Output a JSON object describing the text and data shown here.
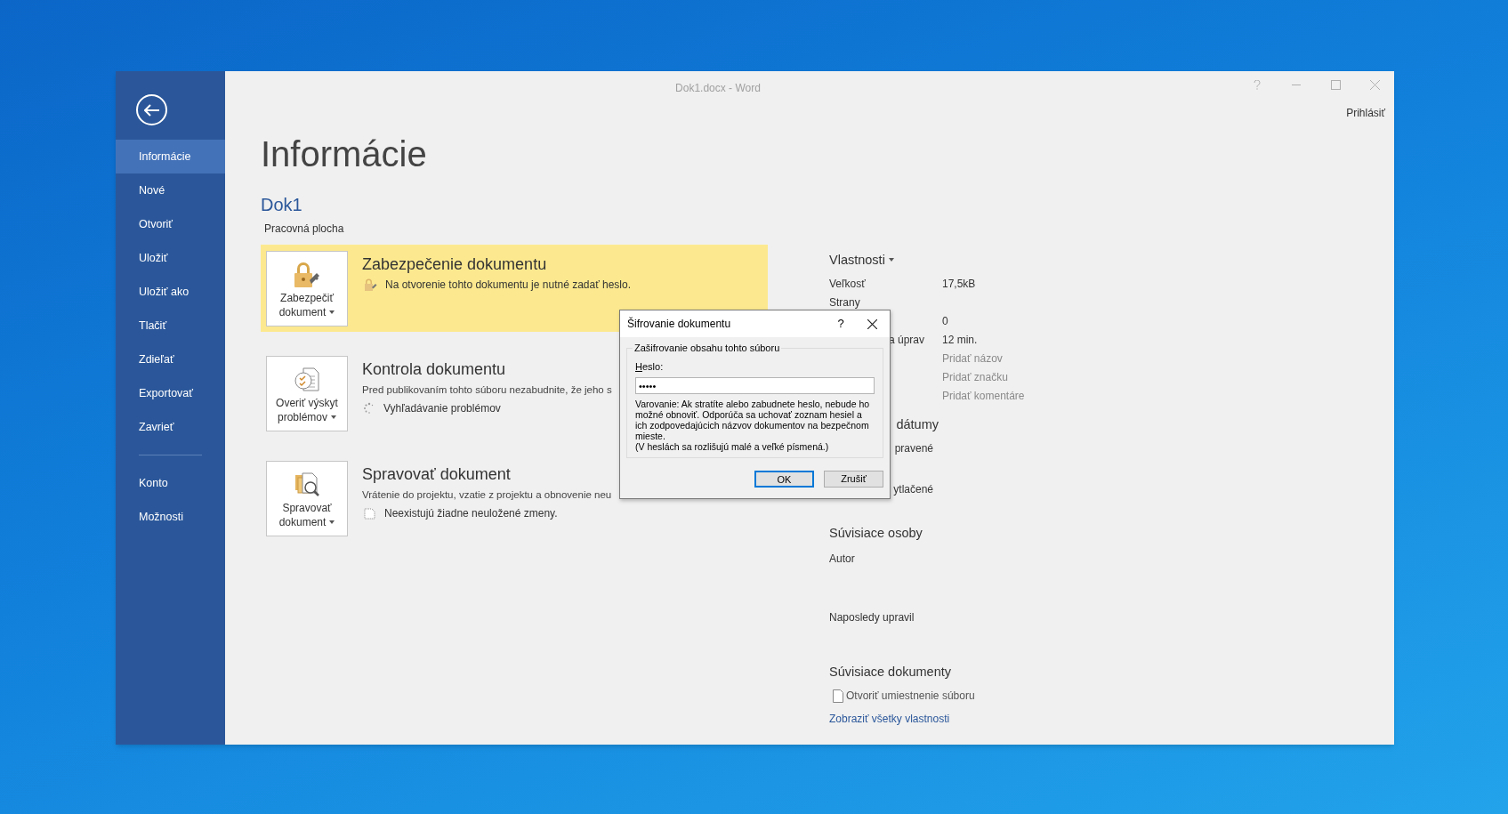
{
  "window": {
    "title": "Dok1.docx - Word",
    "sign_in": "Prihlásiť"
  },
  "sidebar": {
    "items": [
      {
        "label": "Informácie",
        "selected": true
      },
      {
        "label": "Nové",
        "selected": false
      },
      {
        "label": "Otvoriť",
        "selected": false
      },
      {
        "label": "Uložiť",
        "selected": false
      },
      {
        "label": "Uložiť ako",
        "selected": false
      },
      {
        "label": "Tlačiť",
        "selected": false
      },
      {
        "label": "Zdieľať",
        "selected": false
      },
      {
        "label": "Exportovať",
        "selected": false
      },
      {
        "label": "Zavrieť",
        "selected": false
      }
    ],
    "bottom_items": [
      {
        "label": "Konto",
        "selected": false
      },
      {
        "label": "Možnosti",
        "selected": false
      }
    ]
  },
  "page": {
    "title": "Informácie",
    "doc_name": "Dok1",
    "location": "Pracovná plocha"
  },
  "sections": [
    {
      "button": "Zabezpečiť dokument",
      "title": "Zabezpečenie dokumentu",
      "highlighted": true,
      "status": {
        "kind": "lock",
        "text": "Na otvorenie tohto dokumentu je nutné zadať heslo."
      }
    },
    {
      "button": "Overiť výskyt problémov",
      "title": "Kontrola dokumentu",
      "highlighted": false,
      "description": "Pred publikovaním tohto súboru nezabudnite, že jeho s",
      "status": {
        "kind": "spinner",
        "text": "Vyhľadávanie problémov"
      }
    },
    {
      "button": "Spravovať dokument",
      "title": "Spravovať dokument",
      "highlighted": false,
      "description": "Vrátenie do projektu, vzatie z projektu a obnovenie neu",
      "status": {
        "kind": "doc",
        "text": "Neexistujú žiadne neuložené zmeny."
      }
    }
  ],
  "properties": {
    "title": "Vlastnosti",
    "rows": [
      {
        "label": "Veľkosť",
        "value": "17,5kB"
      },
      {
        "label": "Strany"
      },
      {
        "value": "0"
      },
      {
        "label_tail": "a úprav",
        "value": "12 min."
      },
      {
        "placeholder": "Pridať názov"
      },
      {
        "placeholder": "Pridať značku"
      },
      {
        "placeholder": "Pridať komentáre"
      }
    ],
    "dates_title": "dátumy",
    "dates": [
      {
        "label": "pravené"
      },
      {
        "label": "ytlačené"
      }
    ],
    "people_title": "Súvisiace osoby",
    "people": [
      "Autor",
      "Naposledy upravil"
    ],
    "docs_title": "Súvisiace dokumenty",
    "open_location": "Otvoriť umiestnenie súboru",
    "show_all": "Zobraziť všetky vlastnosti"
  },
  "dialog": {
    "title": "Šifrovanie dokumentu",
    "help": "?",
    "group": "Zašifrovanie obsahu tohto súboru",
    "field_label": "Heslo:",
    "value": "•••••",
    "warning": "Varovanie: Ak stratíte alebo zabudnete heslo, nebude ho možné obnoviť. Odporúča sa uchovať zoznam hesiel a ich zodpovedajúcich názvov dokumentov na bezpečnom mieste.",
    "note": "(V heslách sa rozlišujú malé a veľké písmená.)",
    "buttons": [
      {
        "label": "OK",
        "default": true
      },
      {
        "label": "Zrušiť",
        "default": false
      }
    ]
  }
}
